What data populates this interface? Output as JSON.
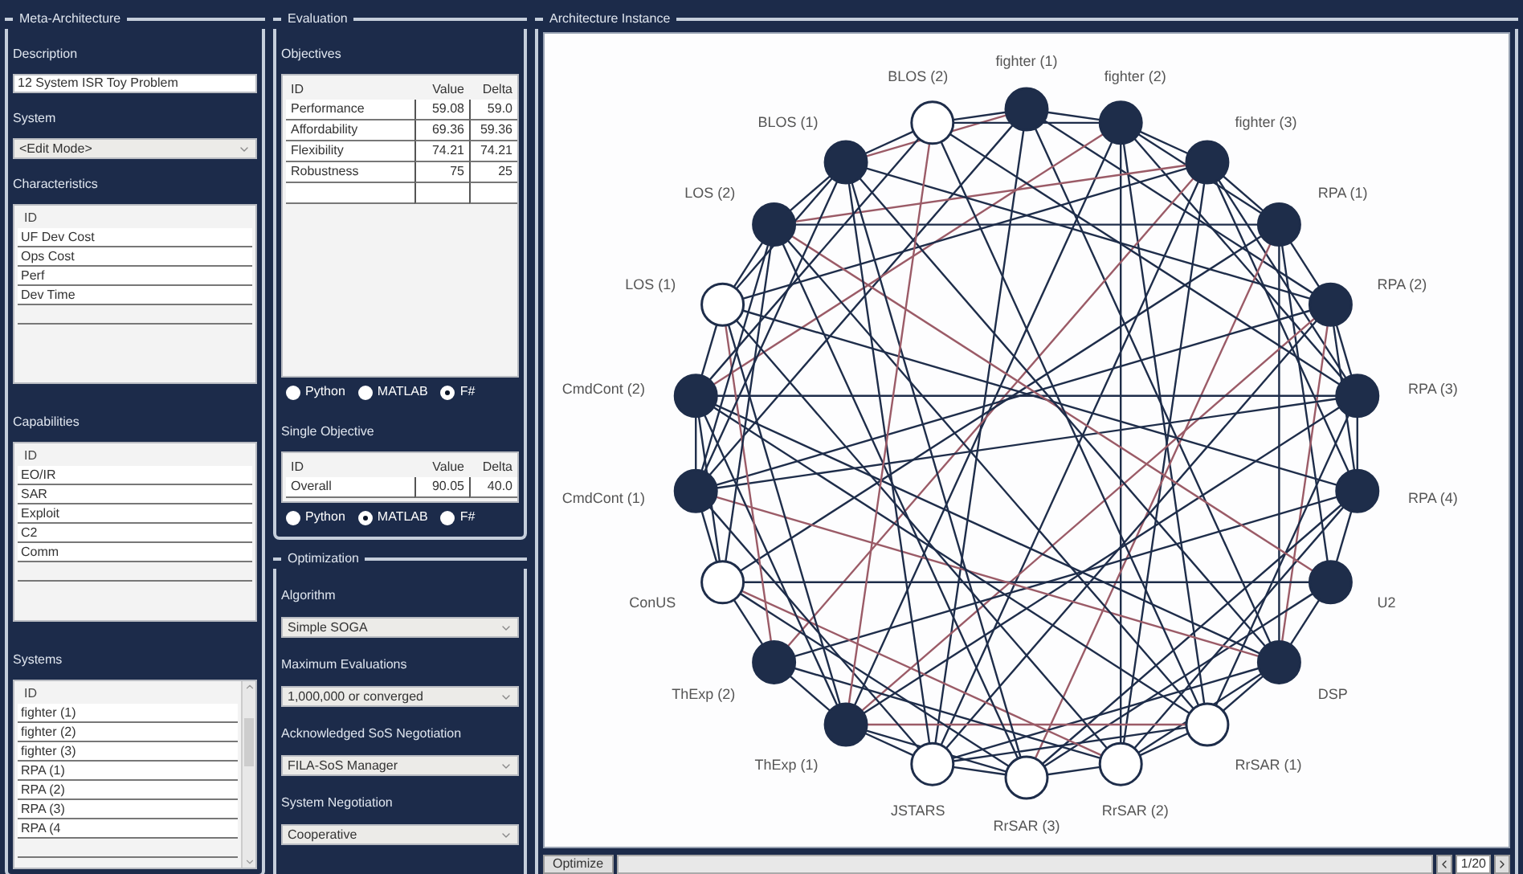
{
  "meta": {
    "title": "Meta-Architecture",
    "description": {
      "label": "Description",
      "value": "12 System ISR Toy Problem"
    },
    "system": {
      "label": "System",
      "value": "<Edit Mode>"
    },
    "characteristics": {
      "label": "Characteristics",
      "header": "ID",
      "rows": [
        "UF Dev Cost",
        "Ops Cost",
        "Perf",
        "Dev Time"
      ]
    },
    "capabilities": {
      "label": "Capabilities",
      "header": "ID",
      "rows": [
        "EO/IR",
        "SAR",
        "Exploit",
        "C2",
        "Comm"
      ]
    },
    "systems": {
      "label": "Systems",
      "header": "ID",
      "rows": [
        "fighter (1)",
        "fighter (2)",
        "fighter (3)",
        "RPA (1)",
        "RPA (2)",
        "RPA (3)",
        "RPA (4"
      ]
    }
  },
  "evaluation": {
    "title": "Evaluation",
    "objectives": {
      "label": "Objectives",
      "columns": [
        "ID",
        "Value",
        "Delta"
      ],
      "rows": [
        [
          "Performance",
          "59.08",
          "59.0"
        ],
        [
          "Affordability",
          "69.36",
          "59.36"
        ],
        [
          "Flexibility",
          "74.21",
          "74.21"
        ],
        [
          "Robustness",
          "75",
          "25"
        ]
      ]
    },
    "objective_languages": [
      {
        "label": "Python",
        "selected": false
      },
      {
        "label": "MATLAB",
        "selected": false
      },
      {
        "label": "F#",
        "selected": true
      }
    ],
    "single_objective": {
      "label": "Single Objective",
      "columns": [
        "ID",
        "Value",
        "Delta"
      ],
      "rows": [
        [
          "Overall",
          "90.05",
          "40.0"
        ]
      ]
    },
    "single_languages": [
      {
        "label": "Python",
        "selected": false
      },
      {
        "label": "MATLAB",
        "selected": true
      },
      {
        "label": "F#",
        "selected": false
      }
    ]
  },
  "optimization": {
    "title": "Optimization",
    "fields": [
      {
        "label": "Algorithm",
        "value": "Simple SOGA"
      },
      {
        "label": "Maximum Evaluations",
        "value": "1,000,000 or converged"
      },
      {
        "label": "Acknowledged SoS Negotiation",
        "value": "FILA-SoS Manager"
      },
      {
        "label": "System Negotiation",
        "value": "Cooperative"
      }
    ]
  },
  "architecture": {
    "title": "Architecture Instance",
    "right_nodes": [
      {
        "label": "fighter (1)",
        "filled": true
      },
      {
        "label": "fighter (2)",
        "filled": true
      },
      {
        "label": "fighter (3)",
        "filled": true
      },
      {
        "label": "RPA (1)",
        "filled": true
      },
      {
        "label": "RPA (2)",
        "filled": true
      },
      {
        "label": "RPA (3)",
        "filled": true
      },
      {
        "label": "RPA (4)",
        "filled": true
      },
      {
        "label": "U2",
        "filled": true
      },
      {
        "label": "DSP",
        "filled": true
      },
      {
        "label": "RrSAR (1)",
        "filled": false
      },
      {
        "label": "RrSAR (2)",
        "filled": false
      },
      {
        "label": "RrSAR (3)",
        "filled": false
      }
    ],
    "left_nodes": [
      {
        "label": "BLOS (2)",
        "filled": false
      },
      {
        "label": "BLOS (1)",
        "filled": true
      },
      {
        "label": "LOS (2)",
        "filled": true
      },
      {
        "label": "LOS (1)",
        "filled": false
      },
      {
        "label": "CmdCont (2)",
        "filled": true
      },
      {
        "label": "CmdCont (1)",
        "filled": true
      },
      {
        "label": "ConUS",
        "filled": false
      },
      {
        "label": "ThExp (2)",
        "filled": true
      },
      {
        "label": "ThExp (1)",
        "filled": true
      },
      {
        "label": "JSTARS",
        "filled": false
      }
    ],
    "optimize_button": "Optimize",
    "page": "1/20"
  }
}
